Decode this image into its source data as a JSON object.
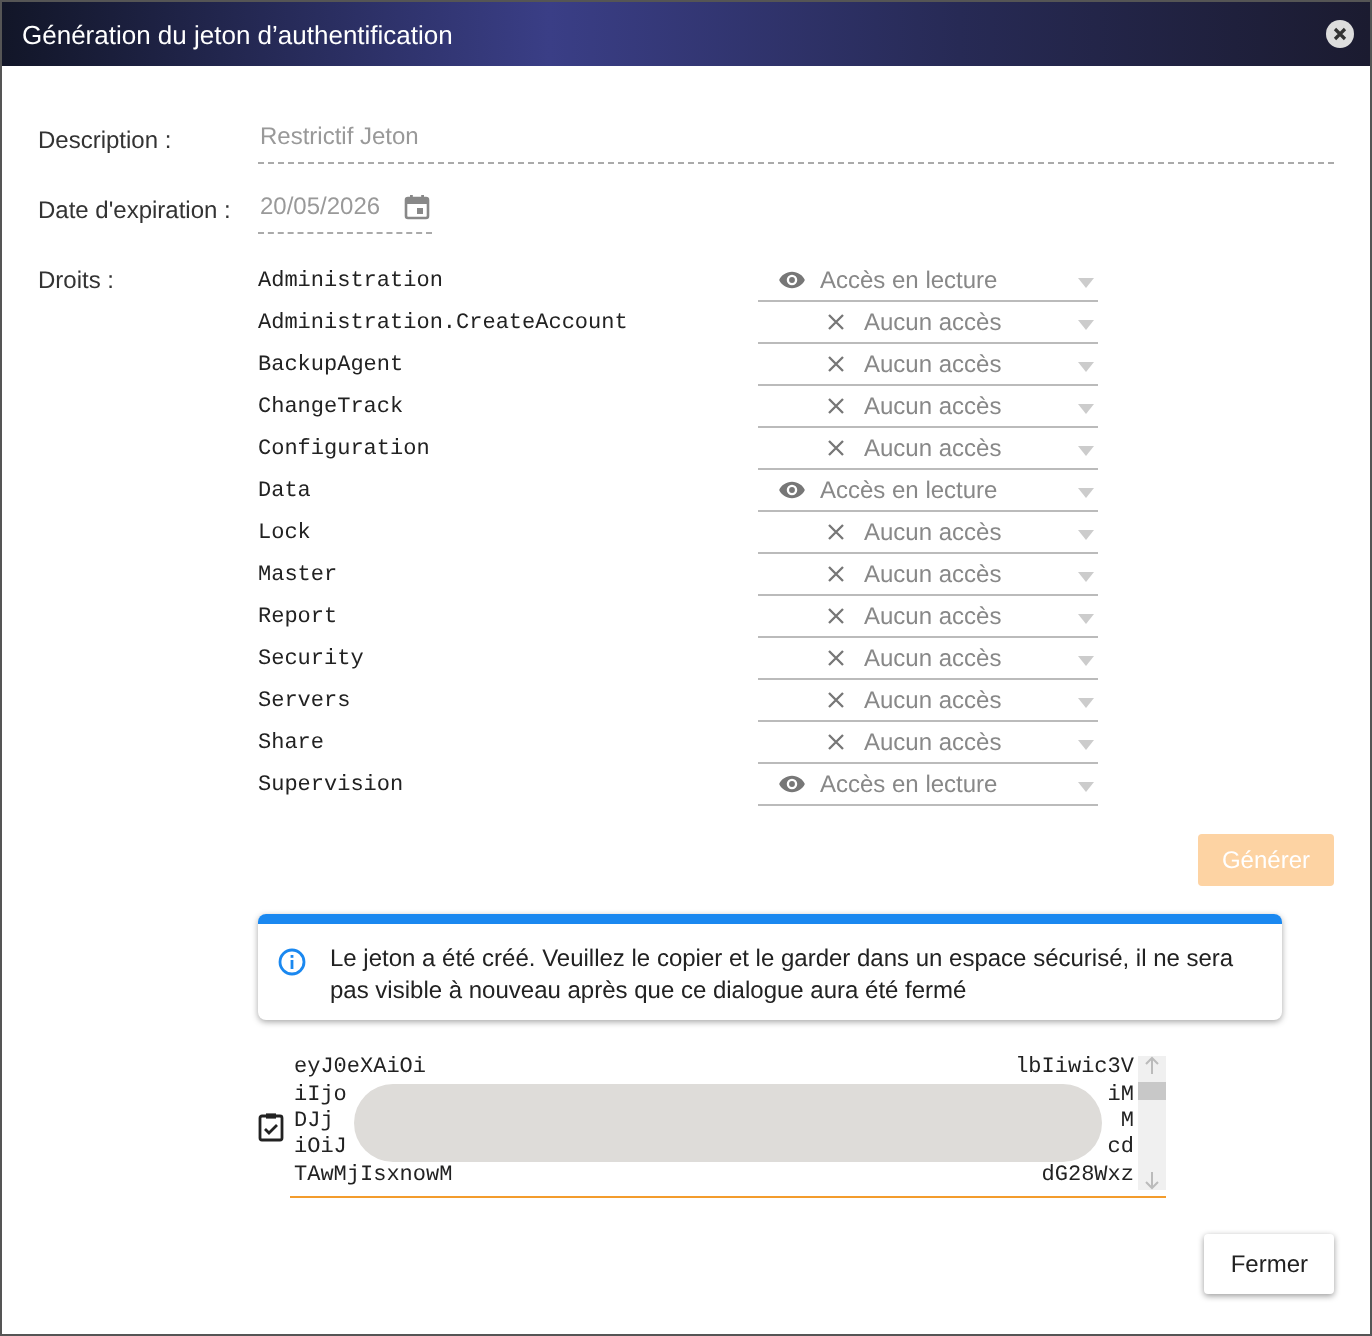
{
  "window": {
    "title": "Génération du jeton d’authentification"
  },
  "fields": [
    {
      "label": "Description :",
      "value": "Restrictif Jeton",
      "kind": "text"
    },
    {
      "label": "Date d'expiration :",
      "value": "20/05/2026",
      "kind": "date"
    }
  ],
  "rights": {
    "label": "Droits :",
    "items": [
      {
        "name": "Administration",
        "access": "Accès en lecture",
        "kind": "read"
      },
      {
        "name": "Administration.CreateAccount",
        "access": "Aucun accès",
        "kind": "none"
      },
      {
        "name": "BackupAgent",
        "access": "Aucun accès",
        "kind": "none"
      },
      {
        "name": "ChangeTrack",
        "access": "Aucun accès",
        "kind": "none"
      },
      {
        "name": "Configuration",
        "access": "Aucun accès",
        "kind": "none"
      },
      {
        "name": "Data",
        "access": "Accès en lecture",
        "kind": "read"
      },
      {
        "name": "Lock",
        "access": "Aucun accès",
        "kind": "none"
      },
      {
        "name": "Master",
        "access": "Aucun accès",
        "kind": "none"
      },
      {
        "name": "Report",
        "access": "Aucun accès",
        "kind": "none"
      },
      {
        "name": "Security",
        "access": "Aucun accès",
        "kind": "none"
      },
      {
        "name": "Servers",
        "access": "Aucun accès",
        "kind": "none"
      },
      {
        "name": "Share",
        "access": "Aucun accès",
        "kind": "none"
      },
      {
        "name": "Supervision",
        "access": "Accès en lecture",
        "kind": "read"
      }
    ]
  },
  "generate_button": {
    "label": "Générer",
    "disabled": true
  },
  "info": {
    "text": "Le jeton a été créé. Veuillez le copier et le garder dans un espace sécurisé, il ne sera pas visible à nouveau après que ce dialogue aura été fermé"
  },
  "token": {
    "lines": [
      {
        "left": "eyJ0eXAiOi",
        "right": "lbIiwic3V"
      },
      {
        "left": "iIjo",
        "right": "iM"
      },
      {
        "left": "DJj",
        "right": "M"
      },
      {
        "left": "iOiJ",
        "right": "cd"
      },
      {
        "left": "TAwMjIsxnowM",
        "right": "dG28Wxz"
      }
    ]
  },
  "close_button": {
    "label": "Fermer"
  }
}
